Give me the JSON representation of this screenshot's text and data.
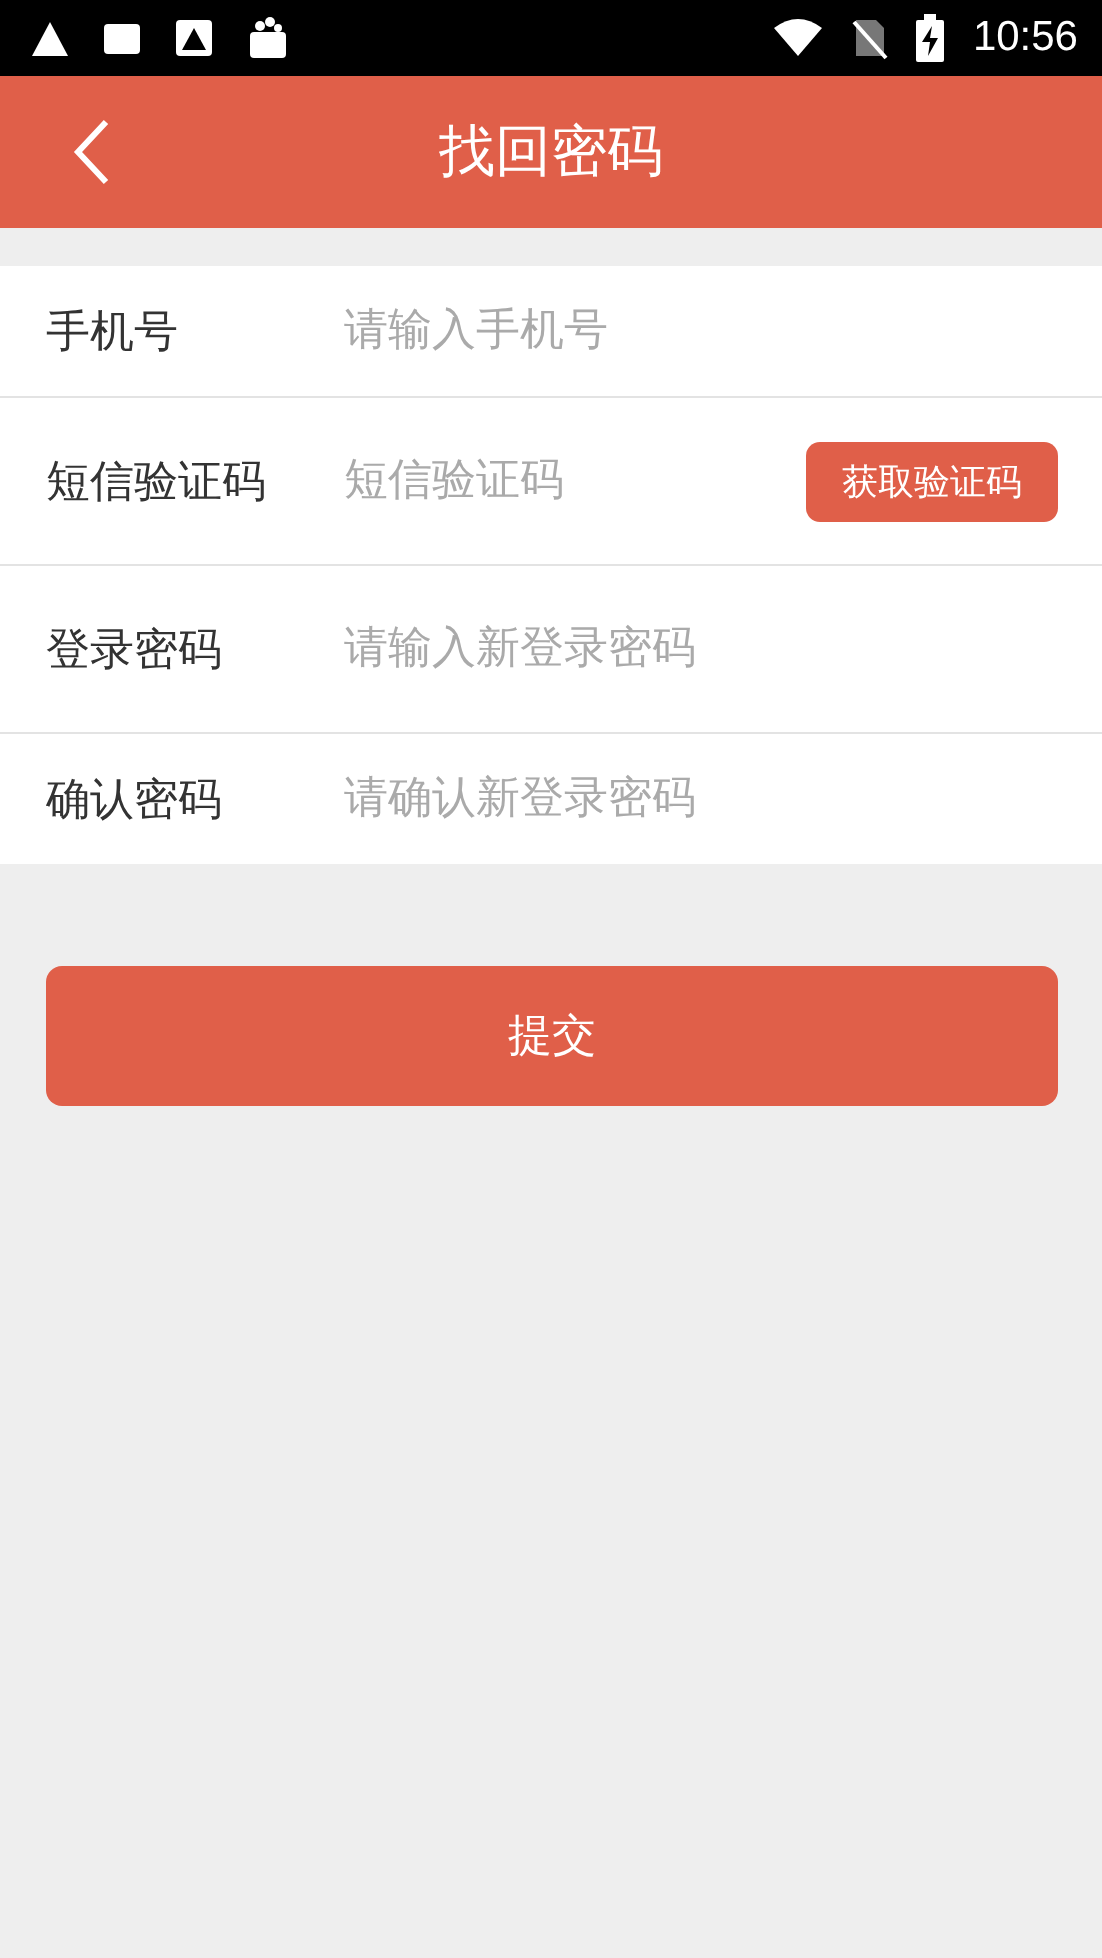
{
  "status_bar": {
    "time": "10:56"
  },
  "header": {
    "title": "找回密码"
  },
  "fields": [
    {
      "kind": "input",
      "label": "手机号",
      "placeholder": "请输入手机号"
    },
    {
      "kind": "code",
      "label": "短信验证码",
      "placeholder": "短信验证码",
      "button": "获取验证码"
    },
    {
      "kind": "input",
      "label": "登录密码",
      "placeholder": "请输入新登录密码"
    },
    {
      "kind": "input",
      "label": "确认密码",
      "placeholder": "请确认新登录密码"
    }
  ],
  "submit": "提交"
}
